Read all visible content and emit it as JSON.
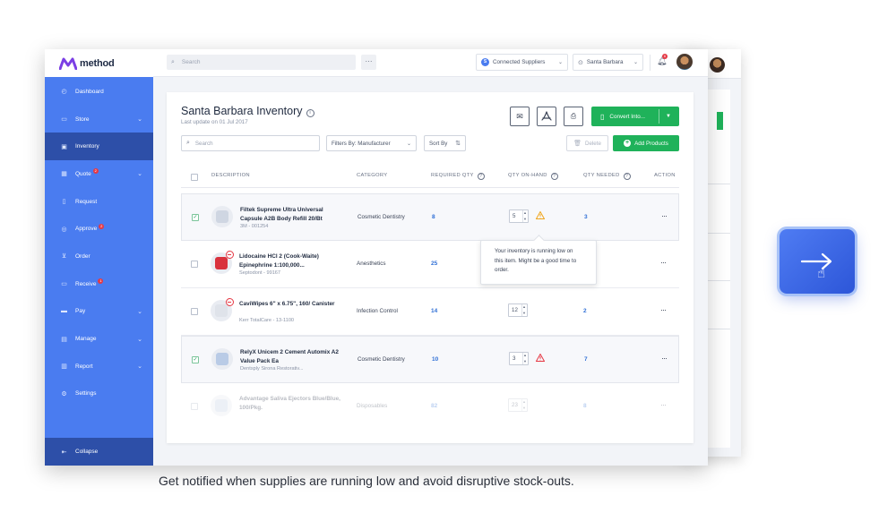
{
  "app": {
    "brand": "method",
    "colors": {
      "sidebar": "#4a7cf0",
      "sidebar_active": "#2d4fa8",
      "accent_green": "#1fb25a",
      "link_blue": "#2f6fd6",
      "alert_red": "#e53945",
      "warning_amber": "#f0a51c"
    }
  },
  "topbar": {
    "search_placeholder": "Search",
    "suppliers_label": "Connected Suppliers",
    "suppliers_badge": "S",
    "location_label": "Santa Barbara",
    "notification_count": "6"
  },
  "sidebar": {
    "items": [
      {
        "label": "Dashboard",
        "icon": "dashboard-icon",
        "chevron": false,
        "badge": ""
      },
      {
        "label": "Store",
        "icon": "store-icon",
        "chevron": true,
        "badge": ""
      },
      {
        "label": "Inventory",
        "icon": "inventory-icon",
        "chevron": false,
        "badge": "",
        "active": true
      },
      {
        "label": "Quote",
        "icon": "quote-icon",
        "chevron": true,
        "badge": "2"
      },
      {
        "label": "Request",
        "icon": "request-icon",
        "chevron": false,
        "badge": ""
      },
      {
        "label": "Approve",
        "icon": "approve-icon",
        "chevron": false,
        "badge": "2"
      },
      {
        "label": "Order",
        "icon": "cart-icon",
        "chevron": false,
        "badge": ""
      },
      {
        "label": "Receive",
        "icon": "truck-icon",
        "chevron": false,
        "badge": "1"
      },
      {
        "label": "Pay",
        "icon": "card-icon",
        "chevron": true,
        "badge": ""
      },
      {
        "label": "Manage",
        "icon": "manage-icon",
        "chevron": true,
        "badge": ""
      },
      {
        "label": "Report",
        "icon": "report-icon",
        "chevron": true,
        "badge": ""
      },
      {
        "label": "Settings",
        "icon": "gear-icon",
        "chevron": false,
        "badge": ""
      }
    ],
    "collapse_label": "Collapse"
  },
  "inventory": {
    "title": "Santa Barbara Inventory",
    "last_update": "Last update on 01 Jul 2017",
    "convert_label": "Convert Into...",
    "search_placeholder": "Search",
    "filter_label": "Filters By: Manufacturer",
    "sort_label": "Sort By",
    "delete_label": "Delete",
    "add_label": "Add Products",
    "columns": {
      "description": "DESCRIPTION",
      "category": "CATEGORY",
      "required": "REQUIRED QTY",
      "on_hand": "QTY ON-HAND",
      "needed": "QTY NEEDED",
      "action": "ACTION"
    },
    "rows": [
      {
        "name": "Filtek Supreme Ultra Universal Capsule A2B Body Refill 20/Bt",
        "meta": "3M - 001254",
        "category": "Cosmetic Dentistry",
        "required": "8",
        "on_hand": "5",
        "needed": "3",
        "checked": true,
        "warning": "amber"
      },
      {
        "name": "Lidocaine HCl 2 (Cook-Waite) Epinephrine 1:100,000...",
        "meta": "Septodont - 99167",
        "category": "Anesthetics",
        "required": "25",
        "on_hand": "",
        "needed": "",
        "checked": false,
        "warning": ""
      },
      {
        "name": "CaviWipes 6\" x 6.75\", 160/ Canister",
        "meta": "Kerr TotalCare - 13-1100",
        "category": "Infection Control",
        "required": "14",
        "on_hand": "12",
        "needed": "2",
        "checked": false,
        "warning": ""
      },
      {
        "name": "RelyX Unicem 2 Cement Automix A2 Value Pack Ea",
        "meta": "Dentsply Sirona Restorativ...",
        "category": "Cosmetic Dentistry",
        "required": "10",
        "on_hand": "3",
        "needed": "7",
        "checked": true,
        "warning": "red"
      },
      {
        "name": "Advantage Saliva Ejectors Blue/Blue, 100/Pkg.",
        "meta": "",
        "category": "Disposables",
        "required": "82",
        "on_hand": "23",
        "needed": "8",
        "checked": false,
        "warning": ""
      }
    ],
    "tooltip": "Your inventory is running low on this item. Might be a good time to order.",
    "action_glyph": "···"
  },
  "caption": "Get notified when supplies are running low and avoid disruptive stock-outs."
}
